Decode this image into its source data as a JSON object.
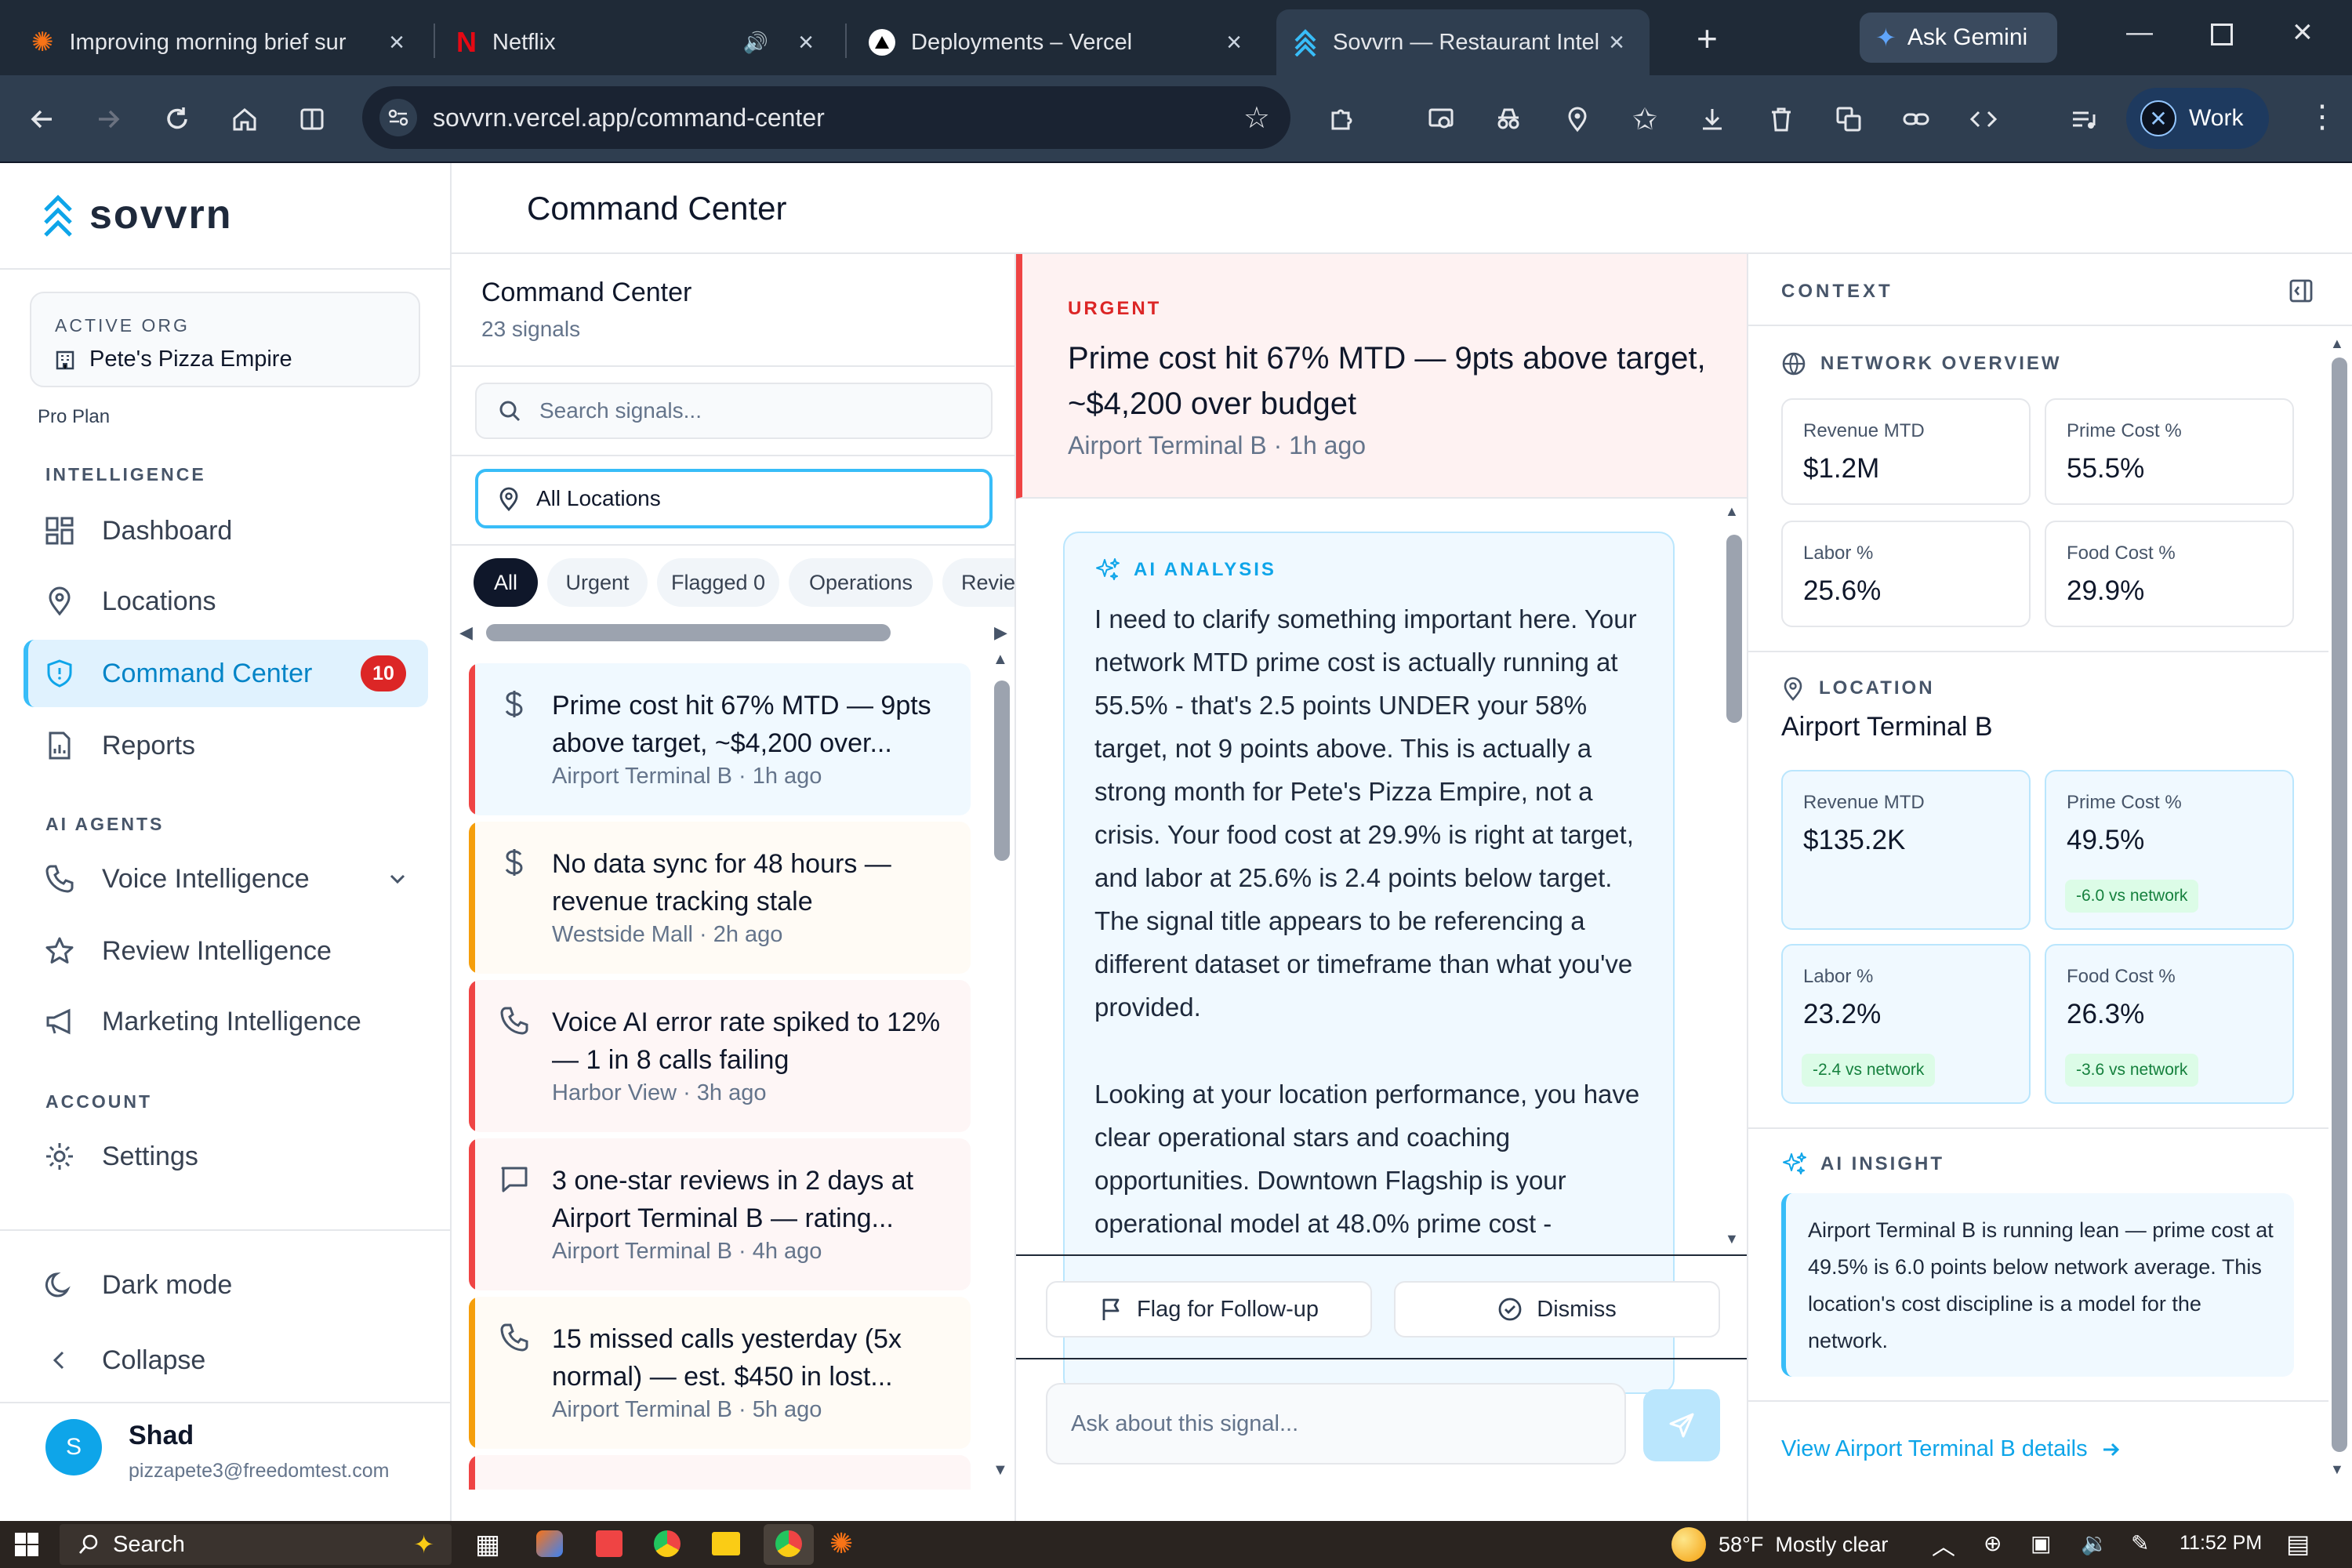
{
  "browser": {
    "tabs": [
      {
        "title": "Improving morning brief sur",
        "icon": "sparkle-icon"
      },
      {
        "title": "Netflix",
        "icon": "netflix-icon"
      },
      {
        "title": "Deployments – Vercel",
        "icon": "vercel-icon"
      },
      {
        "title": "Sovvrn — Restaurant Intellig",
        "icon": "sovvrn-icon"
      }
    ],
    "ask_gemini": "Ask Gemini",
    "url": "sovvrn.vercel.app/command-center",
    "profile": "Work"
  },
  "sidebar": {
    "brand": "sovvrn",
    "org_label": "ACTIVE ORG",
    "org_name": "Pete's Pizza Empire",
    "plan": "Pro Plan",
    "sec_intel": "INTELLIGENCE",
    "sec_agents": "AI AGENTS",
    "sec_account": "ACCOUNT",
    "nav": {
      "dashboard": "Dashboard",
      "locations": "Locations",
      "command_center": "Command Center",
      "command_center_badge": "10",
      "reports": "Reports",
      "voice": "Voice Intelligence",
      "review": "Review Intelligence",
      "marketing": "Marketing Intelligence",
      "settings": "Settings"
    },
    "dark_mode": "Dark mode",
    "collapse": "Collapse",
    "user": {
      "initial": "S",
      "name": "Shad",
      "email": "pizzapete3@freedomtest.com"
    }
  },
  "page": {
    "title": "Command Center"
  },
  "list": {
    "title": "Command Center",
    "count": "23 signals",
    "search_placeholder": "Search signals...",
    "location_filter": "All Locations",
    "chips": [
      "All",
      "Urgent",
      "Flagged 0",
      "Operations",
      "Revie"
    ],
    "signals": [
      {
        "title": "Prime cost hit 67% MTD — 9pts above target, ~$4,200 over...",
        "meta": "Airport Terminal B · 1h ago",
        "icon": "dollar-icon",
        "severity": "urgent",
        "selected": true
      },
      {
        "title": "No data sync for 48 hours — revenue tracking stale",
        "meta": "Westside Mall · 2h ago",
        "icon": "dollar-icon",
        "severity": "warning"
      },
      {
        "title": "Voice AI error rate spiked to 12% — 1 in 8 calls failing",
        "meta": "Harbor View · 3h ago",
        "icon": "phone-icon",
        "severity": "urgent"
      },
      {
        "title": "3 one-star reviews in 2 days at Airport Terminal B — rating...",
        "meta": "Airport Terminal B · 4h ago",
        "icon": "message-icon",
        "severity": "urgent"
      },
      {
        "title": "15 missed calls yesterday (5x normal) — est. $450 in lost...",
        "meta": "Airport Terminal B · 5h ago",
        "icon": "phone-icon",
        "severity": "warning"
      }
    ]
  },
  "detail": {
    "severity": "URGENT",
    "title": "Prime cost hit 67% MTD — 9pts above target, ~$4,200 over budget",
    "meta": "Airport Terminal B · 1h ago",
    "ai_label": "AI ANALYSIS",
    "analysis_p1": "I need to clarify something important here. Your network MTD prime cost is actually running at 55.5% - that's 2.5 points UNDER your 58% target, not 9 points above. This is actually a strong month for Pete's Pizza Empire, not a crisis. Your food cost at 29.9% is right at target, and labor at 25.6% is 2.4 points below target. The signal title appears to be referencing a different dataset or timeframe than what you've provided.",
    "analysis_p2": "Looking at your location performance, you have clear operational stars and coaching opportunities. Downtown Flagship is your operational model at 48.0% prime cost -",
    "flag_button": "Flag for Follow-up",
    "dismiss_button": "Dismiss",
    "ask_placeholder": "Ask about this signal..."
  },
  "context": {
    "header": "CONTEXT",
    "network_label": "NETWORK OVERVIEW",
    "network": [
      {
        "label": "Revenue MTD",
        "value": "$1.2M"
      },
      {
        "label": "Prime Cost %",
        "value": "55.5%"
      },
      {
        "label": "Labor %",
        "value": "25.6%"
      },
      {
        "label": "Food Cost %",
        "value": "29.9%"
      }
    ],
    "location_label": "LOCATION",
    "location_name": "Airport Terminal B",
    "location": [
      {
        "label": "Revenue MTD",
        "value": "$135.2K",
        "delta": ""
      },
      {
        "label": "Prime Cost %",
        "value": "49.5%",
        "delta": "-6.0 vs network"
      },
      {
        "label": "Labor %",
        "value": "23.2%",
        "delta": "-2.4 vs network"
      },
      {
        "label": "Food Cost %",
        "value": "26.3%",
        "delta": "-3.6 vs network"
      }
    ],
    "insight_label": "AI INSIGHT",
    "insight": "Airport Terminal B is running lean — prime cost at 49.5% is 6.0 points below network average. This location's cost discipline is a model for the network.",
    "link": "View Airport Terminal B details"
  },
  "taskbar": {
    "search": "Search",
    "weather": "58°F  Mostly clear",
    "time": "11:52 PM"
  },
  "colors": {
    "accent": "#0ea5e9",
    "urgent": "#ef4444",
    "warning": "#f59e0b",
    "badge": "#dc2626",
    "chrome_dark": "#1f2a37"
  }
}
